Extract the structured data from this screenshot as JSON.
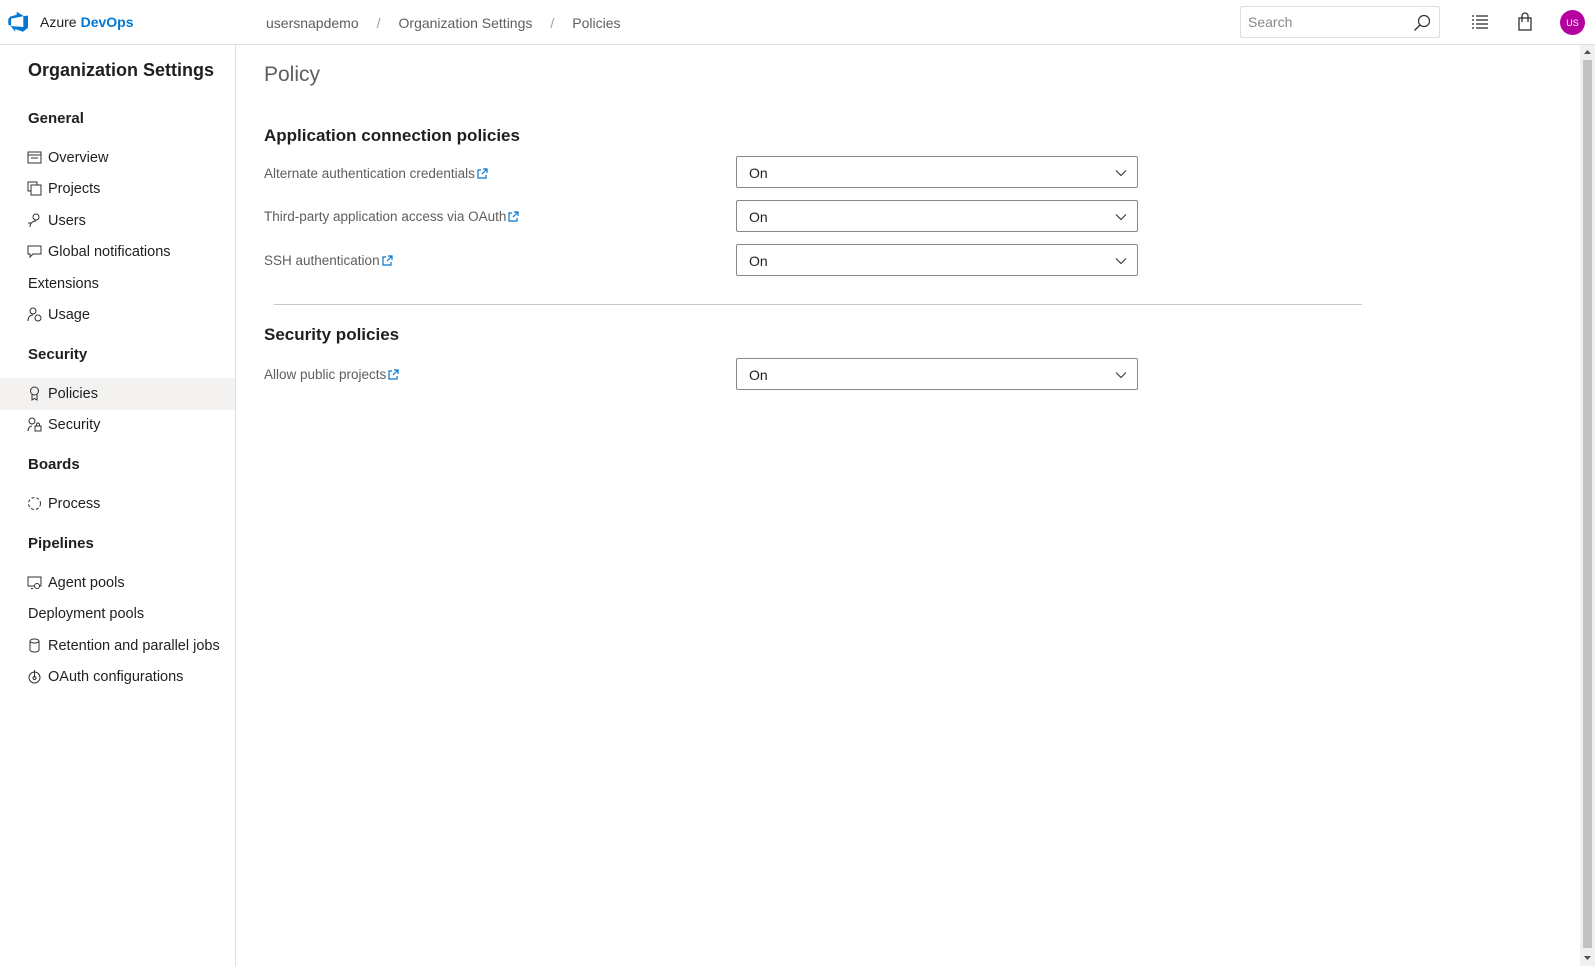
{
  "header": {
    "brand_prefix": "Azure",
    "brand_name": "DevOps",
    "breadcrumbs": [
      "usersnapdemo",
      "Organization Settings",
      "Policies"
    ],
    "search_placeholder": "Search",
    "avatar_initials": "US",
    "avatar_color": "#b4009e"
  },
  "sidebar": {
    "title": "Organization Settings",
    "sections": {
      "general": "General",
      "security": "Security",
      "boards": "Boards",
      "pipelines": "Pipelines"
    },
    "items": {
      "overview": "Overview",
      "projects": "Projects",
      "users": "Users",
      "global_notifications": "Global notifications",
      "extensions": "Extensions",
      "usage": "Usage",
      "policies": "Policies",
      "security": "Security",
      "process": "Process",
      "agent_pools": "Agent pools",
      "deployment_pools": "Deployment pools",
      "retention": "Retention and parallel jobs",
      "oauth": "OAuth configurations"
    },
    "selected": "policies"
  },
  "main": {
    "title": "Policy",
    "app_connection": {
      "heading": "Application connection policies",
      "policies": [
        {
          "label": "Alternate authentication credentials",
          "value": "On"
        },
        {
          "label": "Third-party application access via OAuth",
          "value": "On"
        },
        {
          "label": "SSH authentication",
          "value": "On"
        }
      ]
    },
    "security": {
      "heading": "Security policies",
      "policies": [
        {
          "label": "Allow public projects",
          "value": "On"
        }
      ]
    }
  },
  "colors": {
    "accent": "#0078d4",
    "selected_bg": "#f3f2f1"
  }
}
